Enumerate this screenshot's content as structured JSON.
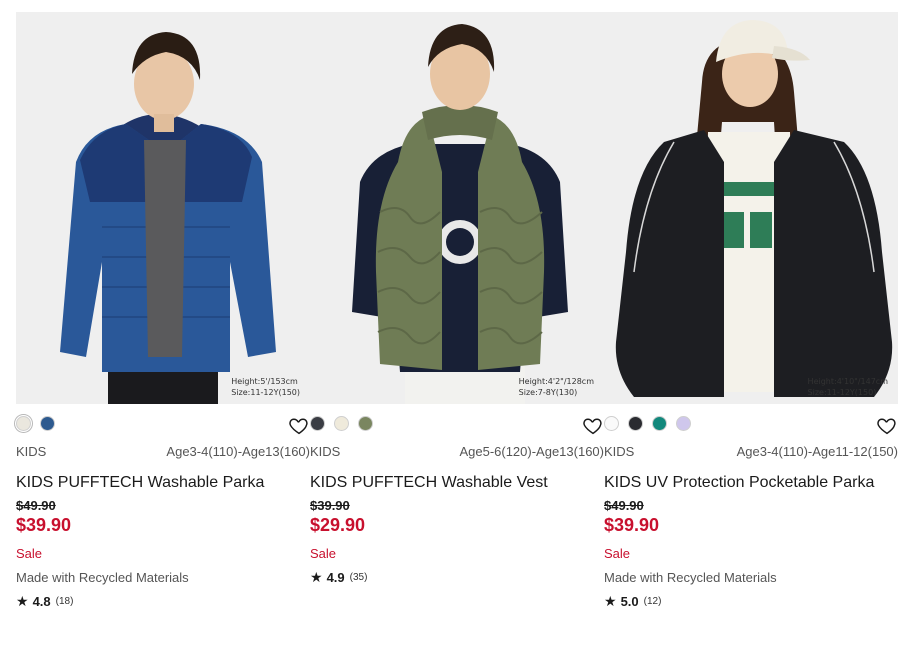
{
  "products": [
    {
      "size_note": [
        "Height:5'/153cm",
        "Size:11-12Y(150)"
      ],
      "swatches": [
        {
          "name": "off-white",
          "color": "#eae7de",
          "selected": true
        },
        {
          "name": "blue",
          "color": "#2d5a8f",
          "selected": false
        }
      ],
      "category": "KIDS",
      "age_range": "Age3-4(110)-Age13(160)",
      "name": "KIDS PUFFTECH Washable Parka",
      "old_price": "$49.90",
      "price": "$39.90",
      "sale": "Sale",
      "note": "Made with Recycled Materials",
      "rating": "4.8",
      "reviews": "(18)"
    },
    {
      "size_note": [
        "Height:4'2\"/128cm",
        "Size:7-8Y(130)"
      ],
      "swatches": [
        {
          "name": "dark-gray",
          "color": "#3a3d44",
          "selected": false
        },
        {
          "name": "natural",
          "color": "#efeadb",
          "selected": false
        },
        {
          "name": "olive",
          "color": "#7a8660",
          "selected": false
        }
      ],
      "category": "KIDS",
      "age_range": "Age5-6(120)-Age13(160)",
      "name": "KIDS PUFFTECH Washable Vest",
      "old_price": "$39.90",
      "price": "$29.90",
      "sale": "Sale",
      "note": "",
      "rating": "4.9",
      "reviews": "(35)"
    },
    {
      "size_note": [
        "Height:4'10\"/147cm",
        "Size:11-12Y(150)"
      ],
      "swatches": [
        {
          "name": "white",
          "color": "#fafafa",
          "selected": false
        },
        {
          "name": "black",
          "color": "#2a2b30",
          "selected": false
        },
        {
          "name": "teal",
          "color": "#12887c",
          "selected": false
        },
        {
          "name": "lavender",
          "color": "#cfc7ec",
          "selected": false
        }
      ],
      "category": "KIDS",
      "age_range": "Age3-4(110)-Age11-12(150)",
      "name": "KIDS UV Protection Pocketable Parka",
      "old_price": "$49.90",
      "price": "$39.90",
      "sale": "Sale",
      "note": "Made with Recycled Materials",
      "rating": "5.0",
      "reviews": "(12)"
    }
  ]
}
